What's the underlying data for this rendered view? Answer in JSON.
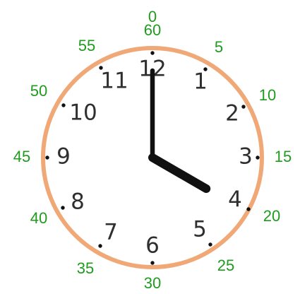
{
  "clock": {
    "time": {
      "hour": 4,
      "minute": 0
    },
    "colors": {
      "background": "#ffffff",
      "ring": "#f0a877",
      "minute_labels": "#1f9b1f",
      "hour_labels": "#2f2f2f",
      "hands": "#111111",
      "dots": "#111111"
    },
    "minute_labels": [
      {
        "value": 60,
        "text": "60"
      },
      {
        "value": 5,
        "text": "5"
      },
      {
        "value": 10,
        "text": "10"
      },
      {
        "value": 15,
        "text": "15"
      },
      {
        "value": 20,
        "text": "20"
      },
      {
        "value": 25,
        "text": "25"
      },
      {
        "value": 30,
        "text": "30"
      },
      {
        "value": 35,
        "text": "35"
      },
      {
        "value": 40,
        "text": "40"
      },
      {
        "value": 45,
        "text": "45"
      },
      {
        "value": 50,
        "text": "50"
      },
      {
        "value": 55,
        "text": "55"
      }
    ],
    "top_extra_label": "0",
    "hour_labels": [
      {
        "value": 12,
        "text": "12"
      },
      {
        "value": 1,
        "text": "1"
      },
      {
        "value": 2,
        "text": "2"
      },
      {
        "value": 3,
        "text": "3"
      },
      {
        "value": 4,
        "text": "4"
      },
      {
        "value": 5,
        "text": "5"
      },
      {
        "value": 6,
        "text": "6"
      },
      {
        "value": 7,
        "text": "7"
      },
      {
        "value": 8,
        "text": "8"
      },
      {
        "value": 9,
        "text": "9"
      },
      {
        "value": 10,
        "text": "10"
      },
      {
        "value": 11,
        "text": "11"
      }
    ]
  }
}
